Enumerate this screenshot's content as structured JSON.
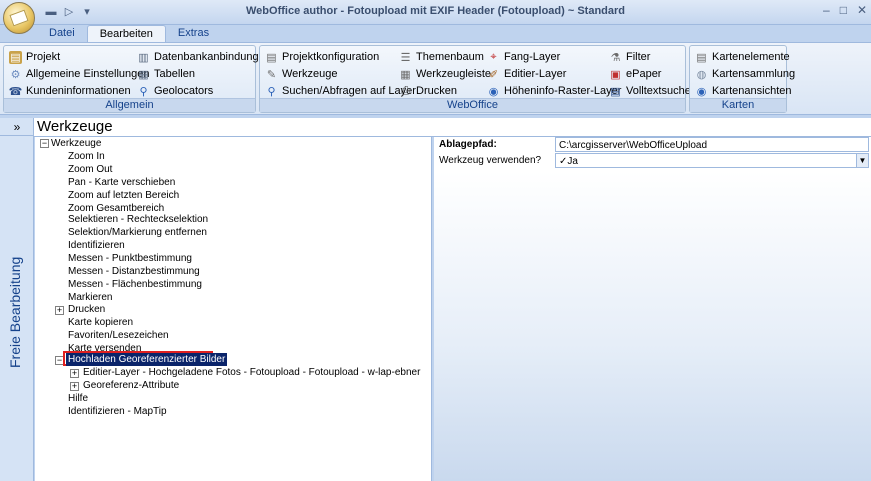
{
  "window": {
    "title": "WebOffice author - Fotoupload mit EXIF Header (Fotoupload) ~ Standard",
    "min_glyph": "–",
    "max_glyph": "□",
    "close_glyph": "✕"
  },
  "qat": {
    "save_glyph": "▬",
    "run_glyph": "▷",
    "menu_glyph": "▾"
  },
  "tabs": [
    {
      "label": "Datei"
    },
    {
      "label": "Bearbeiten"
    },
    {
      "label": "Extras"
    }
  ],
  "ribbon": {
    "allgemein": {
      "label": "Allgemein",
      "items": [
        {
          "label": "Projekt",
          "icon": "project-icon"
        },
        {
          "label": "Allgemeine Einstellungen",
          "icon": "settings-icon"
        },
        {
          "label": "Kundeninformationen",
          "icon": "customer-icon"
        },
        {
          "label": "Datenbankanbindungen",
          "icon": "database-icon"
        },
        {
          "label": "Tabellen",
          "icon": "table-icon"
        },
        {
          "label": "Geolocators",
          "icon": "geolocator-icon"
        }
      ]
    },
    "weboffice": {
      "label": "WebOffice",
      "items": [
        {
          "label": "Projektkonfiguration",
          "icon": "config-icon"
        },
        {
          "label": "Werkzeuge",
          "icon": "tools-icon"
        },
        {
          "label": "Suchen/Abfragen auf Layer",
          "icon": "search-icon"
        },
        {
          "label": "Themenbaum",
          "icon": "themetree-icon"
        },
        {
          "label": "Werkzeugleiste",
          "icon": "toolbar-icon"
        },
        {
          "label": "Drucken",
          "icon": "print-icon"
        },
        {
          "label": "Fang-Layer",
          "icon": "snap-layer-icon"
        },
        {
          "label": "Editier-Layer",
          "icon": "edit-layer-icon"
        },
        {
          "label": "Höheninfo-Raster-Layer",
          "icon": "height-raster-icon"
        },
        {
          "label": "Filter",
          "icon": "filter-icon"
        },
        {
          "label": "ePaper",
          "icon": "epaper-icon"
        },
        {
          "label": "Volltextsuche",
          "icon": "fulltext-icon"
        }
      ]
    },
    "karten": {
      "label": "Karten",
      "items": [
        {
          "label": "Kartenelemente",
          "icon": "map-elements-icon"
        },
        {
          "label": "Kartensammlung",
          "icon": "map-collection-icon"
        },
        {
          "label": "Kartenansichten",
          "icon": "map-views-icon"
        }
      ]
    }
  },
  "sidebar": {
    "expand_glyph": "»",
    "label": "Freie Bearbeitung"
  },
  "panel": {
    "title": "Werkzeuge"
  },
  "tree": {
    "root": "Werkzeuge",
    "items": [
      "Zoom In",
      "Zoom Out",
      "Pan - Karte verschieben",
      "Zoom auf letzten Bereich",
      "Zoom Gesamtbereich",
      "Selektieren - Rechteckselektion",
      "Selektion/Markierung entfernen",
      "Identifizieren",
      "Messen - Punktbestimmung",
      "Messen - Distanzbestimmung",
      "Messen - Flächenbestimmung",
      "Markieren",
      "Drucken",
      "Karte kopieren",
      "Favoriten/Lesezeichen",
      "Karte versenden",
      "Hochladen Georeferenzierter Bilder",
      "Editier-Layer - Hochgeladene Fotos - Fotoupload - Fotoupload - w-lap-ebner",
      "Georeferenz-Attribute",
      "Hilfe",
      "Identifizieren - MapTip"
    ],
    "plus_glyph": "+",
    "minus_glyph": "−"
  },
  "properties": {
    "rows": [
      {
        "label": "Ablagepfad:",
        "value": "C:\\arcgisserver\\WebOfficeUpload"
      },
      {
        "label": "Werkzeug verwenden?",
        "value": "Ja",
        "check": "✓"
      }
    ],
    "dropdown_glyph": "▼"
  }
}
